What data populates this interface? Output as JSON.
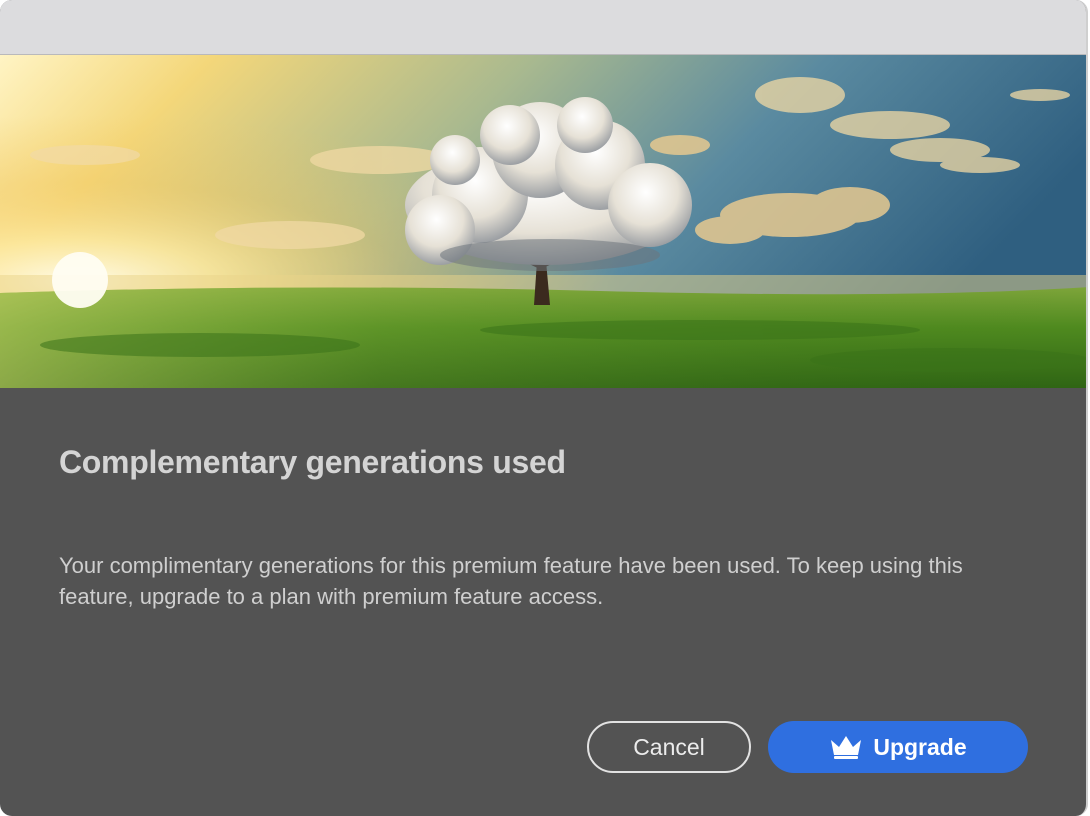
{
  "dialog": {
    "heading": "Complementary generations used",
    "message": "Your complimentary generations for this premium feature have been used. To keep using this feature, upgrade to a plan with premium feature access.",
    "buttons": {
      "cancel_label": "Cancel",
      "upgrade_label": "Upgrade",
      "upgrade_icon": "crown-icon"
    },
    "hero_image": "tree-with-cloud-canopy-on-green-meadow-at-sunrise"
  },
  "colors": {
    "dialog_background": "#535353",
    "titlebar": "#dcdcde",
    "primary_button": "#2f6fe0",
    "heading_text": "#d4d4d4",
    "body_text": "#cfcfcf"
  }
}
